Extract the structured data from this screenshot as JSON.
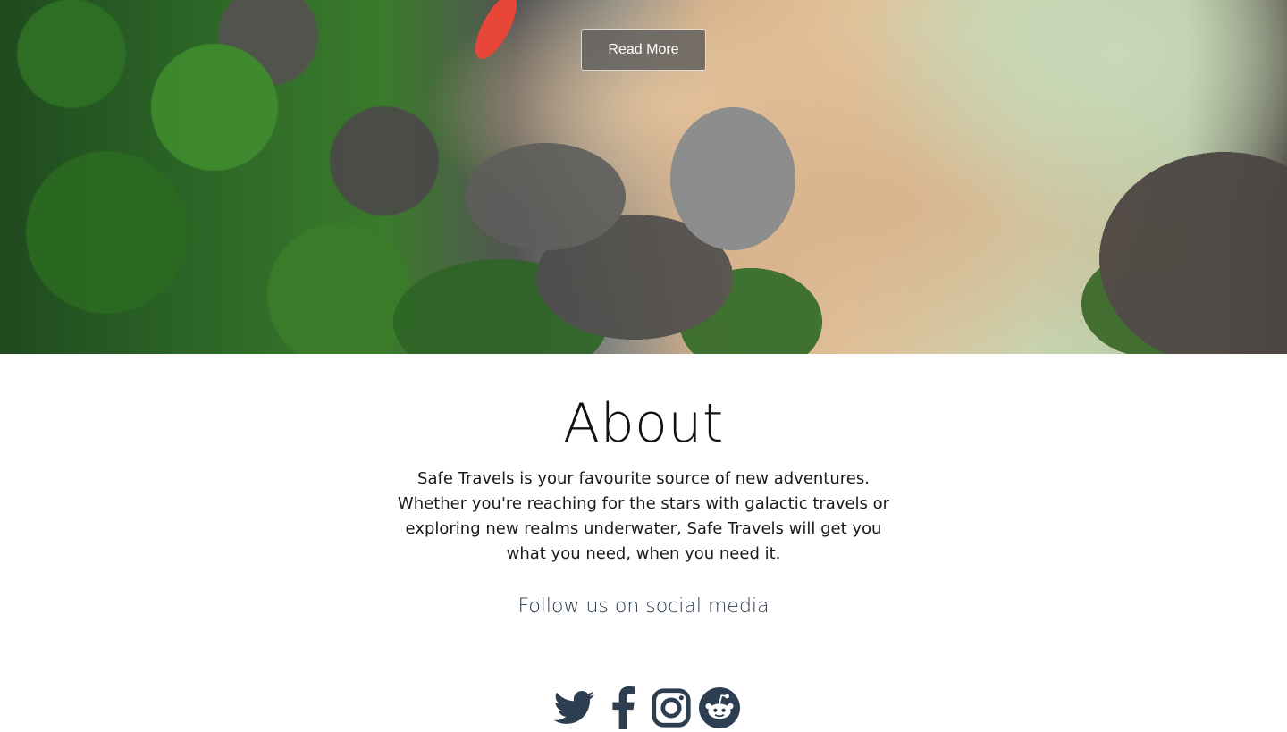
{
  "hero": {
    "cta_label": "Read More",
    "caption_partial": "Safe Travels"
  },
  "about": {
    "title": "About",
    "body": "Safe Travels is your favourite source of new adventures. Whether you're reaching for the stars with galactic travels or exploring new realms underwater, Safe Travels will get you what you need, when you need it.",
    "follow_label": "Follow us on social media"
  },
  "social": {
    "icons": [
      "twitter-icon",
      "facebook-icon",
      "instagram-icon",
      "reddit-icon"
    ],
    "icon_color": "#2c3e50"
  }
}
